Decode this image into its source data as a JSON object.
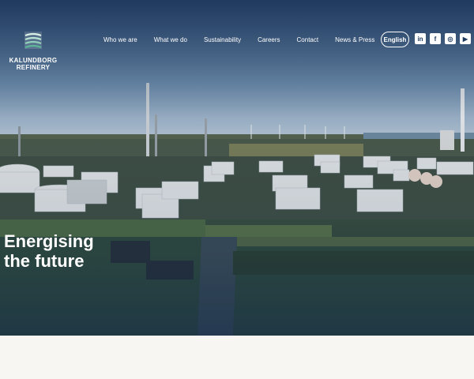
{
  "brand": {
    "name": "KALUNDBORG\nREFINERY",
    "logo_icon": "striped-wave-logo-icon"
  },
  "nav": {
    "items": [
      {
        "label": "Who we are"
      },
      {
        "label": "What we do"
      },
      {
        "label": "Sustainability"
      },
      {
        "label": "Careers"
      },
      {
        "label": "Contact"
      },
      {
        "label": "News & Press"
      }
    ],
    "language": "English"
  },
  "social": [
    {
      "label": "in",
      "icon": "linkedin-icon"
    },
    {
      "label": "f",
      "icon": "facebook-icon"
    },
    {
      "label": "◎",
      "icon": "instagram-icon"
    },
    {
      "label": "▶",
      "icon": "youtube-icon"
    }
  ],
  "hero": {
    "headline": "Energising\nthe future",
    "image": "aerial-refinery-photo"
  },
  "colors": {
    "overlay": "#1d3a5e",
    "sky_top": "#2c4a6e",
    "field": "#2f4a3c",
    "page_bg": "#f7f6f2"
  }
}
